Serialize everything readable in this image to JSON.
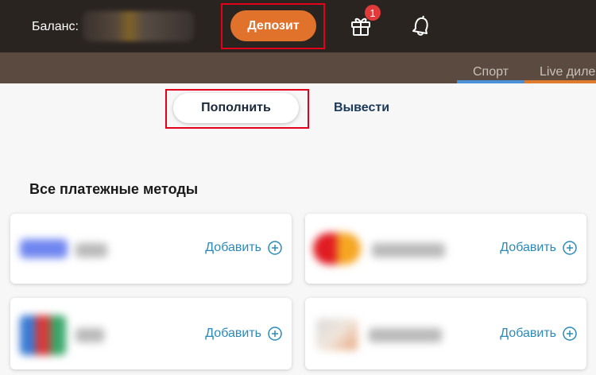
{
  "header": {
    "balance_label": "Баланс:",
    "deposit_label": "Депозит",
    "gift_badge": "1"
  },
  "nav": {
    "tabs": [
      "Спорт",
      "Live диле"
    ]
  },
  "payment_tabs": {
    "topup": "Пополнить",
    "withdraw": "Вывести"
  },
  "section_title": "Все платежные методы",
  "methods": [
    {
      "add_label": "Добавить"
    },
    {
      "add_label": "Добавить"
    },
    {
      "add_label": "Добавить"
    },
    {
      "add_label": "Добавить"
    }
  ],
  "colors": {
    "accent": "#e0722c",
    "highlight": "#e3001b",
    "link": "#2a8ab8"
  }
}
